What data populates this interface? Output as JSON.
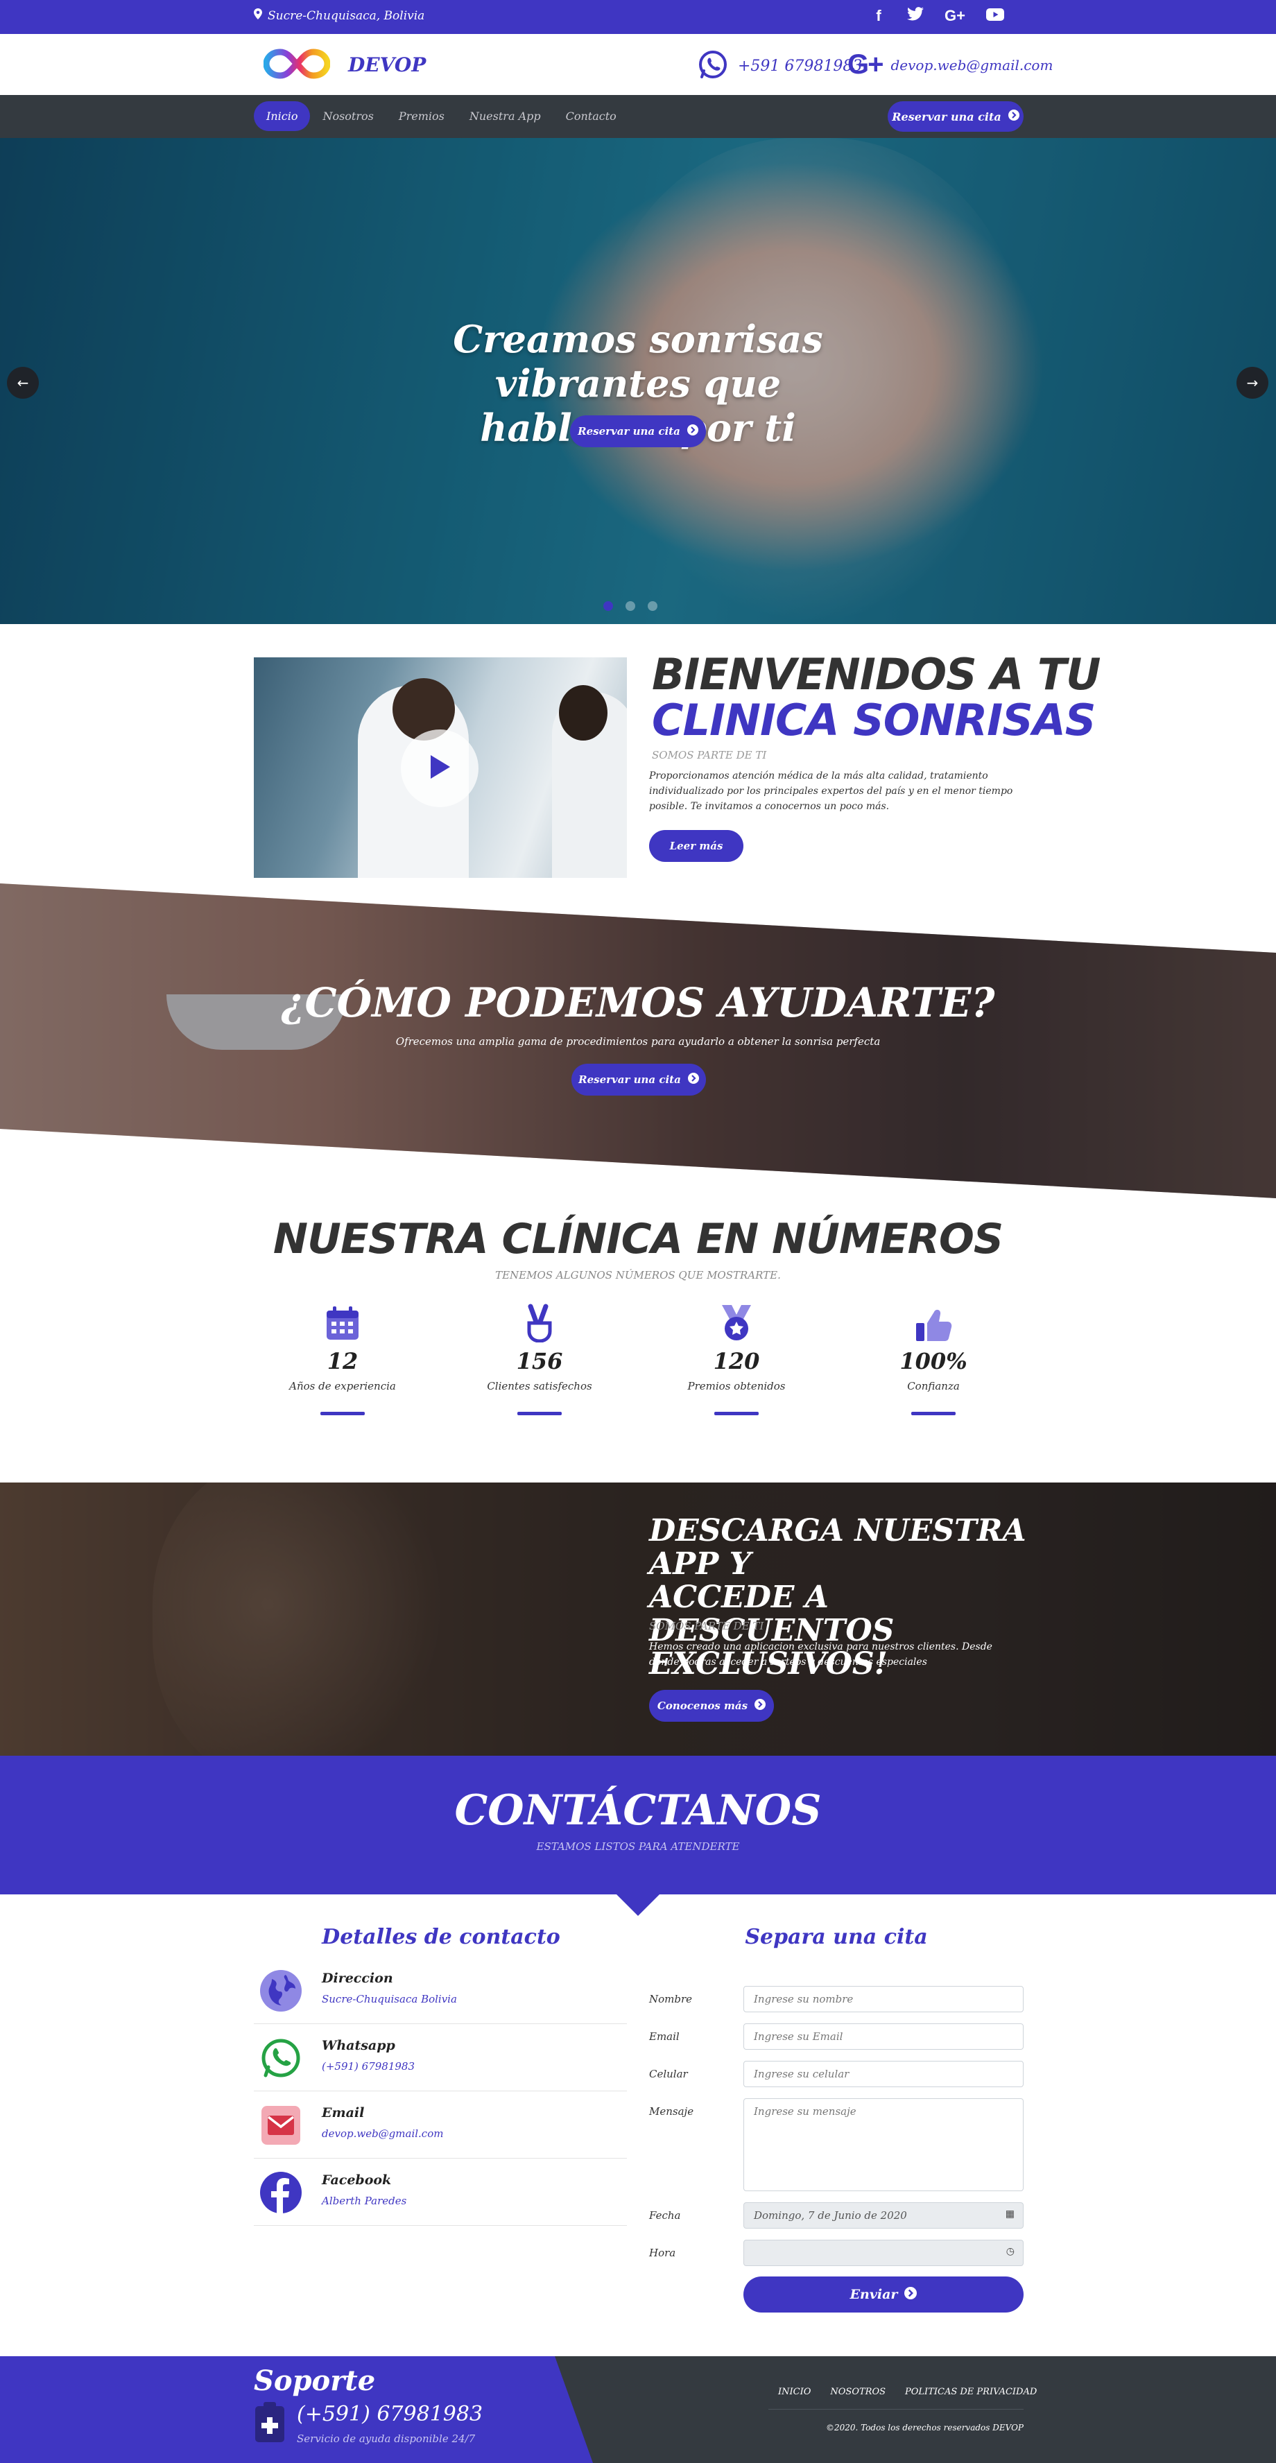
{
  "colors": {
    "accent": "#3f36c2",
    "dark": "#343a40",
    "white": "#ffffff"
  },
  "topbar": {
    "location": "Sucre-Chuquisaca, Bolivia",
    "icons": [
      "facebook-icon",
      "twitter-icon",
      "google-plus-icon",
      "youtube-icon"
    ],
    "social": {
      "facebook": "f",
      "google": "G+"
    }
  },
  "header": {
    "brand": "DEVOP",
    "phone": "+591 67981983",
    "email": "devop.web@gmail.com",
    "email_icon": "G+"
  },
  "nav": {
    "items": [
      {
        "label": "Inicio",
        "active": true
      },
      {
        "label": "Nosotros",
        "active": false
      },
      {
        "label": "Premios",
        "active": false
      },
      {
        "label": "Nuestra App",
        "active": false
      },
      {
        "label": "Contacto",
        "active": false
      }
    ],
    "cta": "Reservar una cita"
  },
  "hero": {
    "title_line1": "Creamos sonrisas vibrantes que",
    "title_line2": "hablaran por ti",
    "button": "Reservar una cita",
    "slides": 3,
    "active_slide": 1
  },
  "welcome": {
    "title_line1": "BIENVENIDOS A TU",
    "title_line2": "CLINICA SONRISAS",
    "subtitle": "SOMOS PARTE DE TI",
    "paragraph": "Proporcionamos atención médica de la más alta calidad, tratamiento individualizado por los principales expertos del país y en el menor tiempo posible. Te invitamos a conocernos un poco más.",
    "button": "Leer más"
  },
  "help": {
    "title": "¿CÓMO PODEMOS AYUDARTE?",
    "subtitle": "Ofrecemos una amplia gama de procedimientos para ayudarlo a obtener la sonrisa perfecta",
    "button": "Reservar una cita"
  },
  "numbers": {
    "title": "NUESTRA CLÍNICA EN NÚMEROS",
    "subtitle": "TENEMOS ALGUNOS NÚMEROS QUE MOSTRARTE.",
    "stats": [
      {
        "icon": "calendar-icon",
        "value": "12",
        "label": "Años de experiencia"
      },
      {
        "icon": "peace-hand-icon",
        "value": "156",
        "label": "Clientes satisfechos"
      },
      {
        "icon": "medal-icon",
        "value": "120",
        "label": "Premios obtenidos"
      },
      {
        "icon": "thumbs-up-icon",
        "value": "100%",
        "label": "Confianza"
      }
    ]
  },
  "app": {
    "title_line1": "DESCARGA NUESTRA APP Y",
    "title_line2": "ACCEDE A DESCUENTOS",
    "title_line3": "EXCLUSIVOS!",
    "subtitle": "SOMOS PARTE DE TI",
    "paragraph": "Hemos creado una aplicacion exclusiva para nuestros clientes. Desde donde podras acceder a sorteos y descuentos especiales",
    "button": "Conocenos más"
  },
  "contact": {
    "title": "CONTÁCTANOS",
    "subtitle": "ESTAMOS LISTOS PARA ATENDERTE",
    "details_title": "Detalles de contacto",
    "details": [
      {
        "icon": "globe-icon",
        "heading": "Direccion",
        "value": "Sucre-Chuquisaca Bolivia"
      },
      {
        "icon": "whatsapp-icon",
        "heading": "Whatsapp",
        "value": "(+591) 67981983"
      },
      {
        "icon": "email-icon",
        "heading": "Email",
        "value": "devop.web@gmail.com"
      },
      {
        "icon": "facebook-icon",
        "heading": "Facebook",
        "value": "Alberth Paredes"
      }
    ],
    "form_title": "Separa una cita",
    "form": {
      "name_label": "Nombre",
      "name_placeholder": "Ingrese su nombre",
      "email_label": "Email",
      "email_placeholder": "Ingrese su Email",
      "phone_label": "Celular",
      "phone_placeholder": "Ingrese su celular",
      "message_label": "Mensaje",
      "message_placeholder": "Ingrese su mensaje",
      "date_label": "Fecha",
      "date_value": "Domingo, 7 de Junio de 2020",
      "time_label": "Hora",
      "time_value": "",
      "submit": "Enviar"
    }
  },
  "footer": {
    "support_title": "Soporte",
    "support_phone": "(+591) 67981983",
    "support_note": "Servicio de ayuda disponible 24/7",
    "links": [
      "INICIO",
      "NOSOTROS",
      "POLITICAS DE PRIVACIDAD"
    ],
    "copyright": "©2020. Todos los derechos reservados DEVOP"
  }
}
